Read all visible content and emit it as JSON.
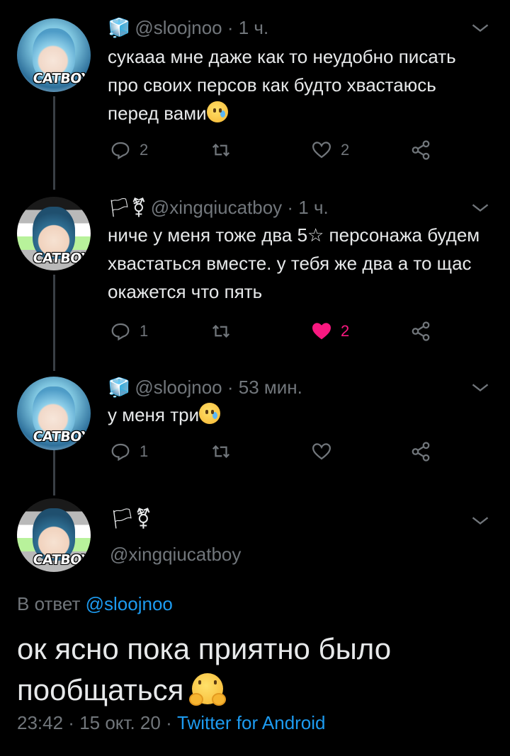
{
  "tweets": [
    {
      "handle": "@sloojnoo",
      "time": "1 ч.",
      "flags": "🧊",
      "badge": "CATBOY",
      "text": "сукааа мне даже как то неудобно писать про своих персов как будто хвастаюсь перед вами",
      "replies": "2",
      "retweets": "",
      "likes": "2",
      "liked": false
    },
    {
      "handle": "@xingqiucatboy",
      "time": "1 ч.",
      "flags": "🏳⚧",
      "badge": "CATBOY",
      "text": "ниче у меня тоже два 5☆ персонажа будем хвастаться вместе. у тебя же два а то щас окажется что пять",
      "replies": "1",
      "retweets": "",
      "likes": "2",
      "liked": true
    },
    {
      "handle": "@sloojnoo",
      "time": "53 мин.",
      "flags": "🧊",
      "badge": "CATBOY",
      "text": "у меня три",
      "replies": "1",
      "retweets": "",
      "likes": "",
      "liked": false
    }
  ],
  "main": {
    "flags": "🏳⚧",
    "handle": "@xingqiucatboy",
    "badge": "CATBOY",
    "replying_prefix": "В ответ",
    "replying_to": "@sloojnoo",
    "text": "ок ясно пока приятно было пообщаться",
    "time": "23:42",
    "date": "15 окт. 20",
    "source": "Twitter for Android"
  },
  "icons": {
    "reply": "reply-icon",
    "retweet": "retweet-icon",
    "like": "heart-icon",
    "share": "share-icon",
    "more": "chevron-down-icon"
  },
  "colors": {
    "background": "#000000",
    "text": "#e7e9ea",
    "muted": "#71767b",
    "link": "#1d9bf0",
    "like": "#f91880"
  }
}
